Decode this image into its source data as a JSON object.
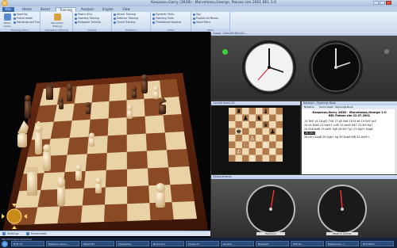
{
  "window": {
    "title": "Kasparov,Garry (2838) - Marvelosso,George, Paksas sim 2001 BEL 1-0"
  },
  "menu": {
    "tabs": [
      "File",
      "Home",
      "Board",
      "Training",
      "Analysis",
      "Engine",
      "View"
    ],
    "active_tab": "Training"
  },
  "ribbon": {
    "groups": [
      {
        "label": "Training Action",
        "items": [
          "Rated Game",
          "Friend mode",
          "Handicap and Fun"
        ],
        "big": "Sparring"
      },
      {
        "label": "Calculation Training",
        "items": [
          "Calculation Training"
        ]
      },
      {
        "label": "Games",
        "items": [
          "Pawns Only",
          "Opening Training",
          "Endgame Training"
        ]
      },
      {
        "label": "Positions",
        "items": [
          "Attack Training",
          "Defence Training",
          "Check Training"
        ]
      },
      {
        "label": "Show",
        "items": [
          "Dynamic Hints",
          "Opening Hints",
          "Threatened Squares"
        ]
      },
      {
        "label": "Hints",
        "items": [
          "Spy",
          "Explain All Moves",
          "Show Plans"
        ]
      }
    ]
  },
  "panes": {
    "clocks_header": "Classic 120m/40 60m/20 ...",
    "board2d_header": "Cockpit board 2D",
    "notation_header": "Notation - Openings Book",
    "notation_tabs": [
      "Notation",
      "Score sheet",
      "Openings Book"
    ],
    "engine_header": "Measurements"
  },
  "game": {
    "players": "Kasparov,Garry 2838 - Marvelosso,George 1-0",
    "event": "BEL Paksas sim 22.07.2001",
    "moves": [
      "15.Ta4! c5 16.g4! Th8 17.g5 Se8 18.f4 e6 19.Sd3 Le5",
      "20.e4 Kxe5 21.fxe5+ Lxf5 22.exd5 De7 23.Sf4 Kg7",
      "24.Sh6 exf6 25.exf5 Tg8 26.Sf4 Tg7 27.Kg2+ Kxg6",
      "28.Dh1 Kxg8 29.Sg6+ hg 30.Dxg6  Kf8 31.Dxf5+"
    ],
    "highlighted_move": "28.Dh1"
  },
  "measurements": {
    "left_label": "Harmony",
    "right_label": "Major in Kolmar"
  },
  "statusbar": {
    "left_text": "Settings",
    "mid_text": "Screenshot",
    "note": "Wei Mit Engine Rehearsal"
  },
  "taskbar": {
    "items": [
      "Fritz 13",
      "Kasparov,Garry...",
      "Mixed Pix",
      "Chess/Plus",
      "Board Scs",
      "Chess 43",
      "Dossier",
      "Notepad",
      "Mhz Gr...",
      "Kasparov(2...)",
      "Bild Editor"
    ]
  },
  "colors": {
    "ribbon_bg": "#dbe6f5",
    "board_light": "#e9d2a6",
    "board_dark": "#8a4a23",
    "clock_face": "#f2f2f2",
    "accent_blue": "#3c6db5"
  }
}
